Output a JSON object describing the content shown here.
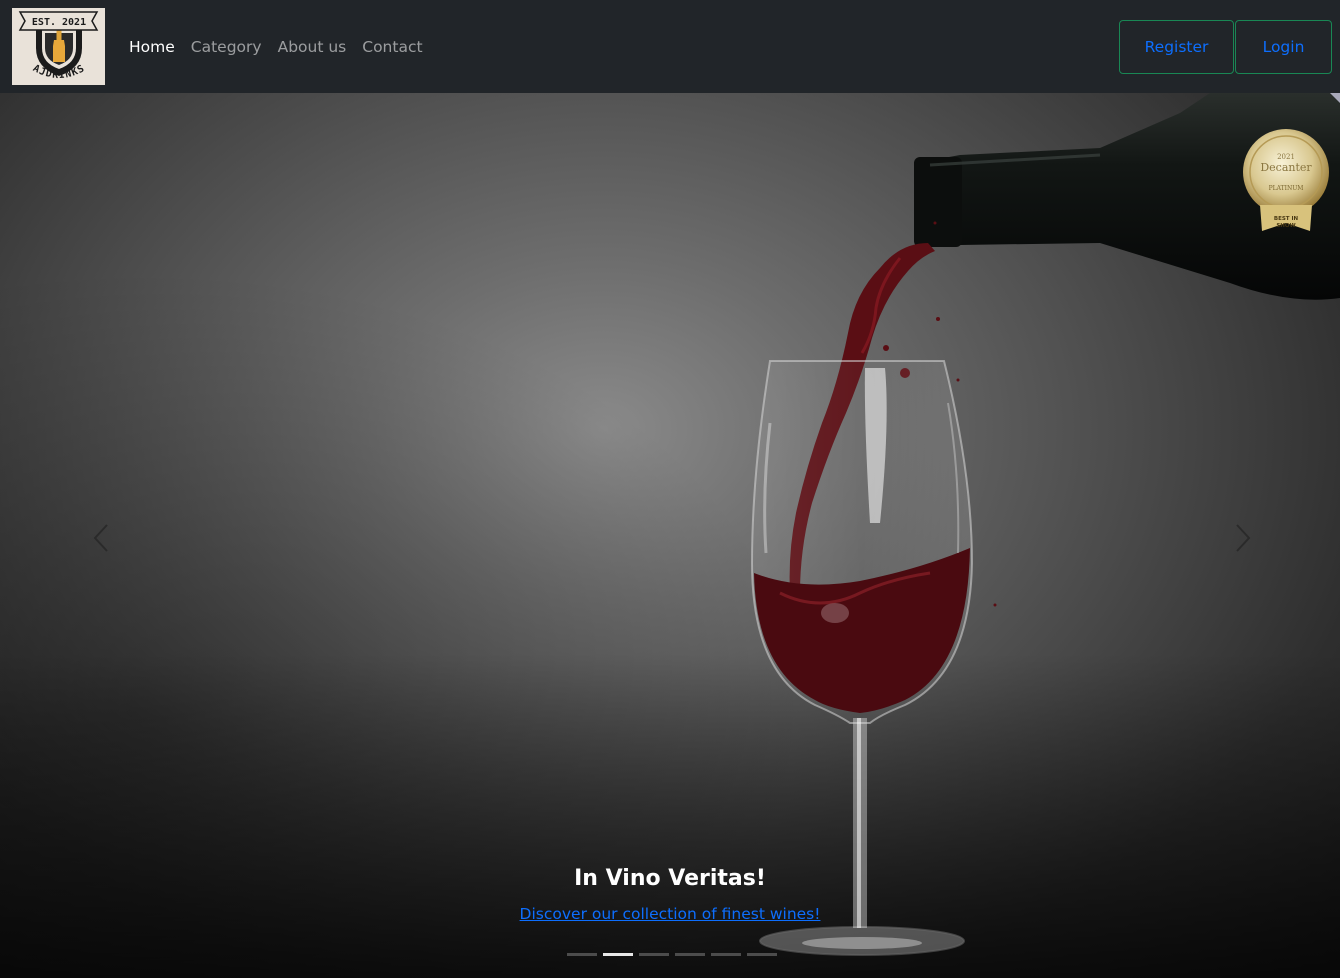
{
  "brand": {
    "logo_text_top": "EST. 2021",
    "logo_text_bottom": "AJDRINKS"
  },
  "nav": {
    "items": [
      {
        "label": "Home",
        "active": true
      },
      {
        "label": "Category",
        "active": false
      },
      {
        "label": "About us",
        "active": false
      },
      {
        "label": "Contact",
        "active": false
      }
    ]
  },
  "auth": {
    "register_label": "Register",
    "login_label": "Login"
  },
  "carousel": {
    "caption_title": "In Vino Veritas!",
    "caption_link": "Discover our collection of finest wines!",
    "slide_count": 6,
    "active_index": 1,
    "bottle_badge": {
      "line1": "2021",
      "line2": "Decanter",
      "line3": "PLATINUM",
      "line4": "BEST IN",
      "line5": "SHOW"
    }
  },
  "colors": {
    "navbar_bg": "#212529",
    "link_blue": "#0d6efd",
    "button_border_green": "#198754",
    "wine_red": "#5a0e14"
  },
  "icons": {
    "prev": "chevron-left-icon",
    "next": "chevron-right-icon"
  }
}
